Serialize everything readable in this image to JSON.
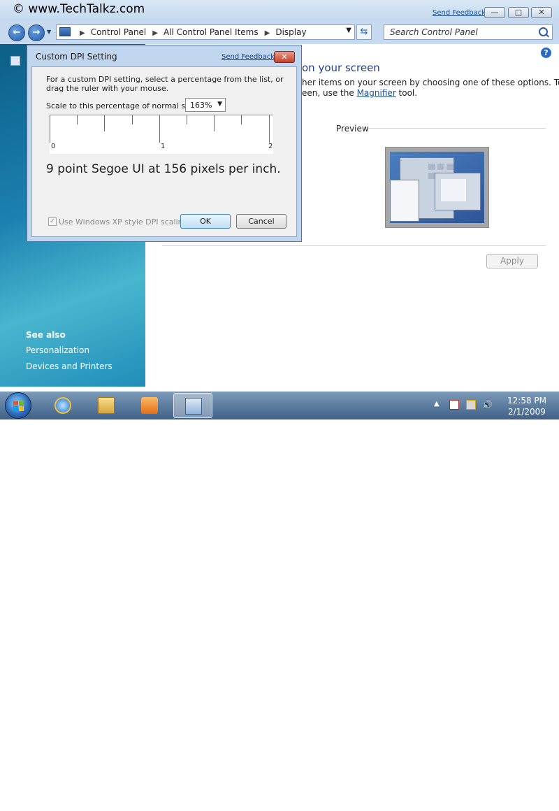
{
  "watermark": "© www.TechTalkz.com",
  "window": {
    "send_feedback": "Send Feedback",
    "caption_buttons": {
      "minimize": "—",
      "maximize": "□",
      "close": "✕"
    }
  },
  "navbar": {
    "breadcrumb": [
      "Control Panel",
      "All Control Panel Items",
      "Display"
    ],
    "search_placeholder": "Search Control Panel"
  },
  "left_pane": {
    "see_also_title": "See also",
    "links": [
      "Personalization",
      "Devices and Printers"
    ]
  },
  "content": {
    "heading": "on your screen",
    "description_line1": "her items on your screen by choosing one of these options. To",
    "description_line2_prefix": "een, use the ",
    "magnifier_link": "Magnifier",
    "description_line2_suffix": " tool.",
    "preview_label": "Preview",
    "apply_button": "Apply"
  },
  "dialog": {
    "title": "Custom DPI Setting",
    "send_feedback": "Send Feedback",
    "close": "✕",
    "instruction_line1": "For a custom DPI setting, select a percentage from the list, or",
    "instruction_line2": "drag the ruler with your mouse.",
    "scale_label": "Scale to this percentage of normal size:",
    "scale_value": "163%",
    "ruler_labels": [
      "0",
      "1",
      "2"
    ],
    "sample_text": "9 point Segoe UI at 156 pixels per inch.",
    "xp_checkbox_label": "Use Windows XP style DPI scaling",
    "xp_checkbox_checked": true,
    "ok_button": "OK",
    "cancel_button": "Cancel"
  },
  "taskbar": {
    "items": [
      "internet-explorer-icon",
      "windows-explorer-icon",
      "media-player-icon",
      "display-icon"
    ],
    "active_item": "display-icon",
    "clock_time": "12:58 PM",
    "clock_date": "2/1/2009"
  }
}
